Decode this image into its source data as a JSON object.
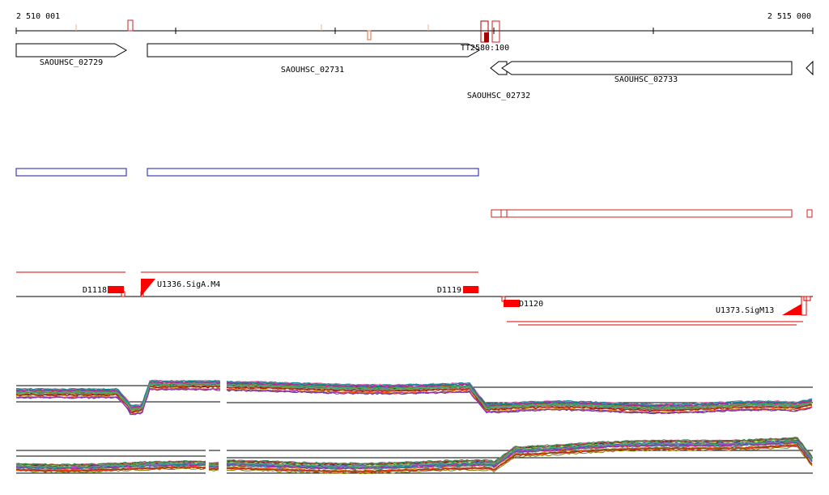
{
  "ruler": {
    "start_label": "2 510 001",
    "end_label": "2 515 000"
  },
  "genes": [
    {
      "label": "SAOUHSC_02729",
      "strand": "+"
    },
    {
      "label": "SAOUHSC_02731",
      "strand": "+"
    },
    {
      "label": "SAOUHSC_02732",
      "strand": "-"
    },
    {
      "label": "SAOUHSC_02733",
      "strand": "-"
    }
  ],
  "feature_labels": {
    "tt": "TT2580:100",
    "d1118": "D1118",
    "d1119": "D1119",
    "d1120": "D1120",
    "u1336": "U1336.SigA.M4",
    "u_right": "U1373.SigM13"
  },
  "colors": {
    "gene_outline": "#000000",
    "operon_plus": "#1a1aa8",
    "operon_minus": "#cc2222",
    "segment_line": "#dd0000",
    "feature_fill": "#ff0000",
    "peak_light": "#f4b28a"
  },
  "tracks": {
    "expression_top_series": 28,
    "expression_bottom_series": 28
  }
}
